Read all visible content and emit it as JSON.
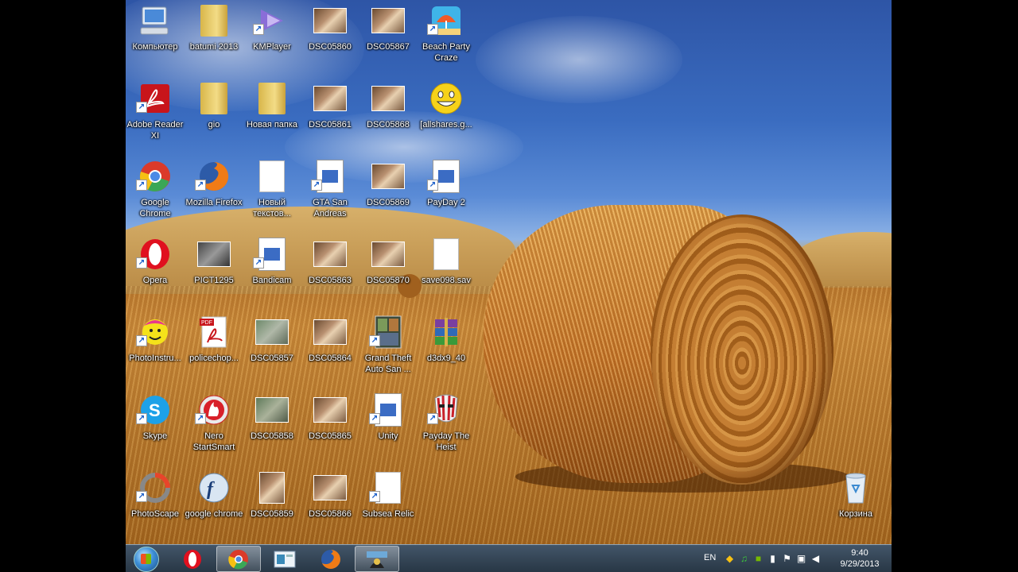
{
  "desktop": {
    "icons": [
      {
        "label": "Компьютер",
        "icon": "computer-icon"
      },
      {
        "label": "batumi 2013",
        "icon": "folder-icon"
      },
      {
        "label": "KMPlayer",
        "icon": "kmplayer-icon"
      },
      {
        "label": "DSC05860",
        "icon": "photo-icon"
      },
      {
        "label": "DSC05867",
        "icon": "photo-icon"
      },
      {
        "label": "Beach Party Craze",
        "icon": "game-icon"
      },
      {
        "label": "Adobe Reader XI",
        "icon": "adobe-reader-icon"
      },
      {
        "label": "gio",
        "icon": "folder-icon"
      },
      {
        "label": "Новая папка",
        "icon": "folder-icon"
      },
      {
        "label": "DSC05861",
        "icon": "photo-icon"
      },
      {
        "label": "DSC05868",
        "icon": "photo-icon"
      },
      {
        "label": "[allshares.g...",
        "icon": "smiley-icon"
      },
      {
        "label": "Google Chrome",
        "icon": "chrome-icon"
      },
      {
        "label": "Mozilla Firefox",
        "icon": "firefox-icon"
      },
      {
        "label": "Новый текстов...",
        "icon": "text-document-icon"
      },
      {
        "label": "GTA San Andreas",
        "icon": "application-icon"
      },
      {
        "label": "DSC05869",
        "icon": "photo-icon"
      },
      {
        "label": "PayDay 2",
        "icon": "application-icon"
      },
      {
        "label": "Opera",
        "icon": "opera-icon"
      },
      {
        "label": "PICT1295",
        "icon": "video-icon"
      },
      {
        "label": "Bandicam",
        "icon": "application-icon"
      },
      {
        "label": "DSC05863",
        "icon": "photo-icon"
      },
      {
        "label": "DSC05870",
        "icon": "photo-icon"
      },
      {
        "label": "save098.sav",
        "icon": "file-icon"
      },
      {
        "label": "PhotoInstru...",
        "icon": "photoinstrument-icon"
      },
      {
        "label": "policechop...",
        "icon": "pdf-icon"
      },
      {
        "label": "DSC05857",
        "icon": "photo-icon"
      },
      {
        "label": "DSC05864",
        "icon": "photo-icon"
      },
      {
        "label": "Grand Theft Auto San ...",
        "icon": "gta-icon"
      },
      {
        "label": "d3dx9_40",
        "icon": "winrar-icon"
      },
      {
        "label": "Skype",
        "icon": "skype-icon"
      },
      {
        "label": "Nero StartSmart",
        "icon": "nero-icon"
      },
      {
        "label": "DSC05858",
        "icon": "photo-icon"
      },
      {
        "label": "DSC05865",
        "icon": "photo-icon"
      },
      {
        "label": "Unity",
        "icon": "application-icon"
      },
      {
        "label": "Payday The Heist",
        "icon": "payday-mask-icon"
      },
      {
        "label": "PhotoScape",
        "icon": "photoscape-icon"
      },
      {
        "label": "google chrome",
        "icon": "flash-icon"
      },
      {
        "label": "DSC05859",
        "icon": "photo-icon"
      },
      {
        "label": "DSC05866",
        "icon": "photo-icon"
      },
      {
        "label": "Subsea Relic",
        "icon": "file-icon"
      },
      {
        "label": "Корзина",
        "icon": "recycle-bin-icon"
      }
    ]
  },
  "taskbar": {
    "pinned": [
      {
        "name": "opera-icon"
      },
      {
        "name": "chrome-icon"
      },
      {
        "name": "window-icon"
      },
      {
        "name": "firefox-icon"
      },
      {
        "name": "bandicam-icon"
      }
    ],
    "language": "EN",
    "time": "9:40",
    "date": "9/29/2013"
  }
}
